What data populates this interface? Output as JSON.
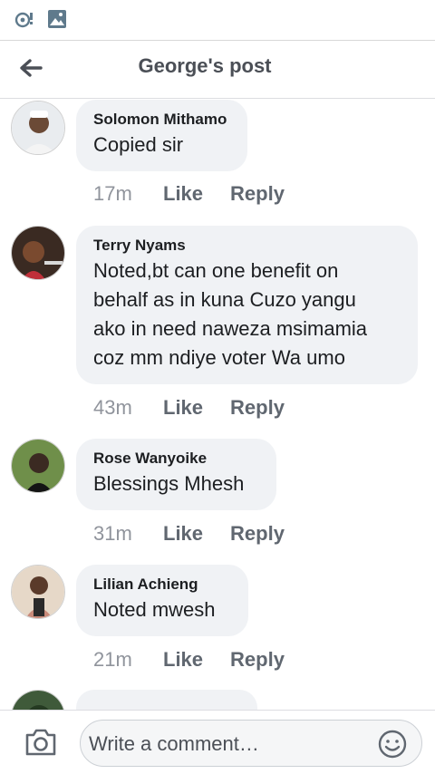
{
  "status_bar": {
    "icons": [
      "vpn-key-icon",
      "image-icon"
    ]
  },
  "header": {
    "title": "George's post",
    "back_icon": "arrow-left-icon"
  },
  "comments": [
    {
      "author": "Solomon Mithamo",
      "text": "Copied sir",
      "time": "17m",
      "like": "Like",
      "reply": "Reply"
    },
    {
      "author": "Terry Nyams",
      "text_lines": [
        "Noted,bt can one benefit on",
        "behalf as in kuna Cuzo yangu",
        "ako in need naweza  msimamia",
        "coz mm ndiye voter Wa umo"
      ],
      "time": "43m",
      "like": "Like",
      "reply": "Reply"
    },
    {
      "author": "Rose Wanyoike",
      "text": "Blessings Mhesh",
      "time": "31m",
      "like": "Like",
      "reply": "Reply"
    },
    {
      "author": "Lilian Achieng",
      "text": "Noted mwesh",
      "time": "21m",
      "like": "Like",
      "reply": "Reply"
    }
  ],
  "composer": {
    "placeholder": "Write a comment…",
    "camera_icon": "camera-icon",
    "emoji_icon": "smiley-icon"
  },
  "colors": {
    "bubble": "#f0f2f5",
    "meta": "#606770",
    "title": "#4b4f56"
  }
}
